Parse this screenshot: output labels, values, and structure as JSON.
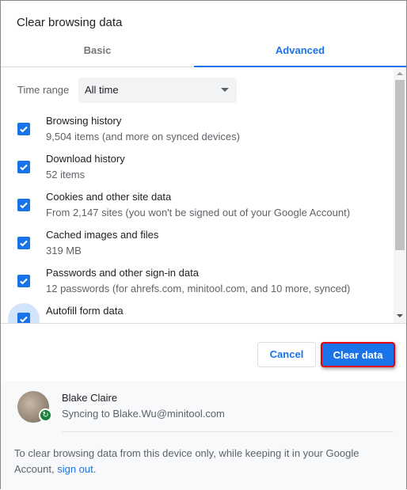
{
  "dialog": {
    "title": "Clear browsing data"
  },
  "tabs": [
    {
      "label": "Basic",
      "active": false
    },
    {
      "label": "Advanced",
      "active": true
    }
  ],
  "time_range": {
    "label": "Time range",
    "value": "All time"
  },
  "items": [
    {
      "name": "Browsing history",
      "desc": "9,504 items (and more on synced devices)",
      "checked": true
    },
    {
      "name": "Download history",
      "desc": "52 items",
      "checked": true
    },
    {
      "name": "Cookies and other site data",
      "desc": "From 2,147 sites (you won't be signed out of your Google Account)",
      "checked": true
    },
    {
      "name": "Cached images and files",
      "desc": "319 MB",
      "checked": true
    },
    {
      "name": "Passwords and other sign-in data",
      "desc": "12 passwords (for ahrefs.com, minitool.com, and 10 more, synced)",
      "checked": true
    },
    {
      "name": "Autofill form data",
      "checked": true
    }
  ],
  "buttons": {
    "cancel": "Cancel",
    "clear": "Clear data"
  },
  "account": {
    "name": "Blake Claire",
    "status": "Syncing to Blake.Wu@minitool.com"
  },
  "footer": {
    "text": "To clear browsing data from this device only, while keeping it in your Google Account,",
    "link": "sign out",
    "end": "."
  },
  "colors": {
    "accent": "#1a73e8",
    "highlight_border": "#e0000b",
    "sync_badge": "#188038"
  }
}
